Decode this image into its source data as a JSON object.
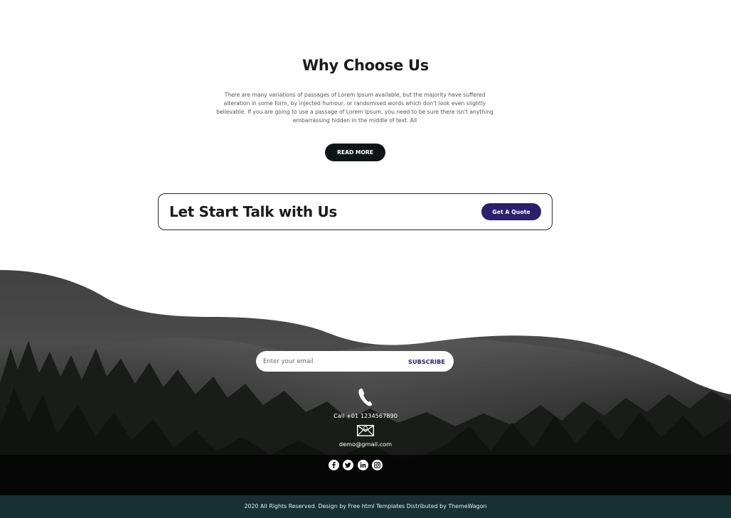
{
  "why": {
    "title": "Why Choose Us",
    "body": "There are many variations of passages of Lorem Ipsum available, but the majority have suffered alteration in some form, by injected humour, or randomised words which don't look even slightly believable. If you are going to use a passage of Lorem Ipsum, you need to be sure there isn't anything embarrassing hidden in the middle of text. All",
    "button": "READ MORE"
  },
  "talk": {
    "title": "Let Start Talk with Us",
    "button": "Get A Quote"
  },
  "subscribe": {
    "placeholder": "Enter your email",
    "button": "SUBSCRIBE"
  },
  "contact": {
    "phone": "Call +01 1234567890",
    "email": "demo@gmail.com",
    "phone_icon": "phone-icon",
    "email_icon": "envelope-icon"
  },
  "social": [
    {
      "name": "facebook-icon",
      "glyph": "f"
    },
    {
      "name": "twitter-icon",
      "glyph": "t"
    },
    {
      "name": "linkedin-icon",
      "glyph": "in"
    },
    {
      "name": "instagram-icon",
      "glyph": "ig"
    }
  ],
  "copyright": "2020 All Rights Reserved. Design by Free html Templates Distributed by ThemeWagon",
  "colors": {
    "dark_button": "#0d1517",
    "quote_button": "#2b1f6e",
    "copyright_bar": "#173033"
  }
}
